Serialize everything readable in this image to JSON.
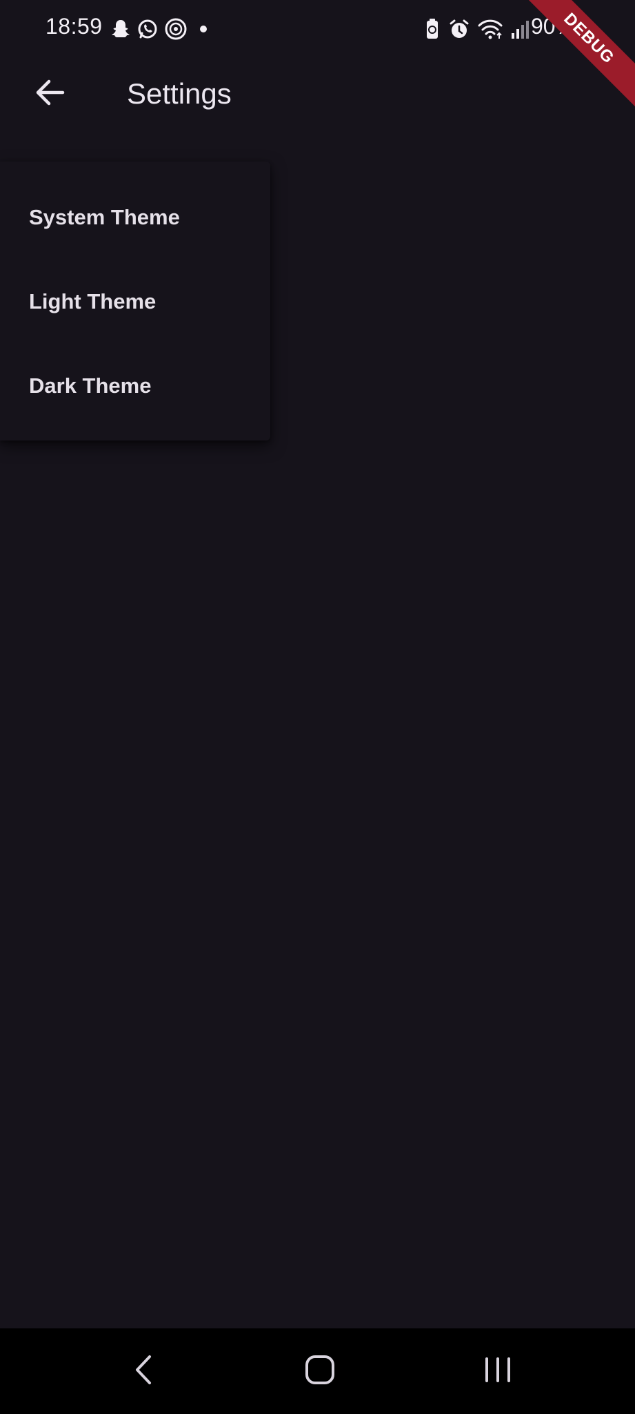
{
  "status_bar": {
    "time": "18:59",
    "battery_percent": "90%",
    "left_icons": [
      "snapchat-icon",
      "whatsapp-icon",
      "threads-icon",
      "dot-icon"
    ],
    "right_icons": [
      "battery-saver-icon",
      "alarm-icon",
      "wifi-icon",
      "signal-icon"
    ]
  },
  "debug_banner": {
    "label": "DEBUG",
    "color": "#9b1c2a"
  },
  "app_bar": {
    "title": "Settings",
    "back_icon": "arrow-back-icon"
  },
  "theme_menu": {
    "items": [
      {
        "label": "System Theme"
      },
      {
        "label": "Light Theme"
      },
      {
        "label": "Dark Theme"
      }
    ]
  },
  "nav_bar": {
    "buttons": [
      "back-nav-icon",
      "home-nav-icon",
      "recents-nav-icon"
    ]
  },
  "colors": {
    "background": "#16131b",
    "text": "#e6e1e9",
    "nav_background": "#000000"
  }
}
